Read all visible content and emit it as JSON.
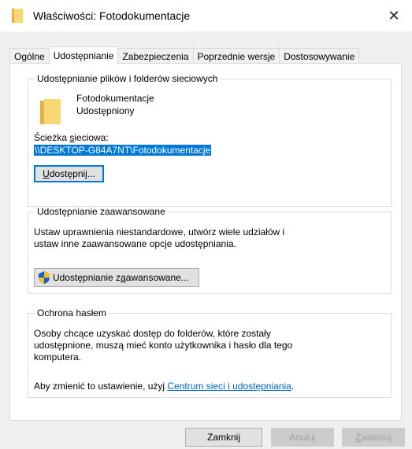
{
  "window": {
    "title": "Właściwości: Fotodokumentacje",
    "close_glyph": "✕"
  },
  "tabs": [
    {
      "label": "Ogólne",
      "active": false
    },
    {
      "label": "Udostępnianie",
      "active": true
    },
    {
      "label": "Zabezpieczenia",
      "active": false
    },
    {
      "label": "Poprzednie wersje",
      "active": false
    },
    {
      "label": "Dostosowywanie",
      "active": false
    }
  ],
  "sharing": {
    "group_title": "Udostępnianie plików i folderów sieciowych",
    "folder_name": "Fotodokumentacje",
    "share_status": "Udostępniony",
    "network_path_label": "Ścieżka sieciowa:",
    "network_path_value": "\\\\DESKTOP-G84A7NT\\Fotodokumentacje",
    "share_button": "Udostępnij..."
  },
  "advanced": {
    "group_title": "Udostępnianie zaawansowane",
    "description": "Ustaw uprawnienia niestandardowe, utwórz wiele udziałów i ustaw inne zaawansowane opcje udostępniania.",
    "button": "Udostępnianie zaawansowane..."
  },
  "password": {
    "group_title": "Ochrona hasłem",
    "description": "Osoby chcące uzyskać dostęp do folderów, które zostały udostępnione, muszą mieć konto użytkownika i hasło dla tego komputera.",
    "change_prefix": "Aby zmienić to ustawienie, użyj ",
    "link": "Centrum sieci i udostępniania",
    "change_suffix": "."
  },
  "footer": {
    "close": "Zamknij",
    "cancel": "Anuluj",
    "apply": "Zastosuj"
  },
  "colors": {
    "selection": "#0078d7",
    "link": "#0066cc",
    "folder": "#f8d775"
  }
}
